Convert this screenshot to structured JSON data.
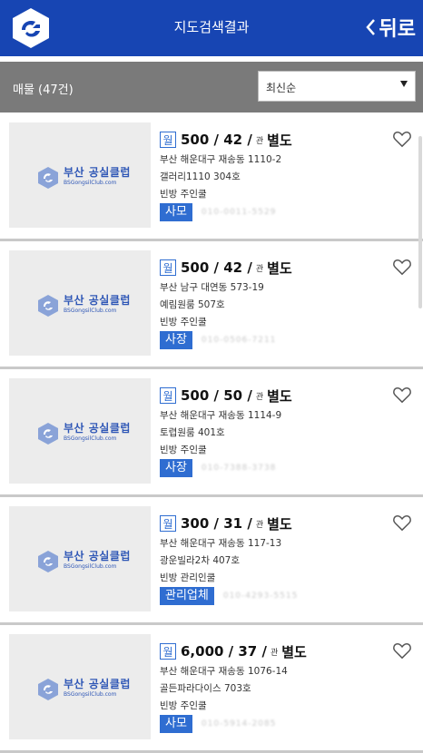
{
  "header": {
    "title": "지도검색결과",
    "back_label": "뒤로"
  },
  "toolbar": {
    "count_label": "매물 (47건)",
    "sort_selected": "최신순"
  },
  "thumbnail": {
    "brand": "부산 공실클럽",
    "site": "BSGongsilClub.com"
  },
  "listings": [
    {
      "type": "월",
      "price": "500 / 42 /",
      "mgmt_label": "관",
      "mgmt_value": "별도",
      "address": "부산 해운대구 재송동 1110-2",
      "building": "갤러리1110 304호",
      "tags": "빈방    주인쿨",
      "badge": "사모",
      "phone": "010-0011-5529"
    },
    {
      "type": "월",
      "price": "500 / 42 /",
      "mgmt_label": "관",
      "mgmt_value": "별도",
      "address": "부산 남구 대연동 573-19",
      "building": "예림원룸 507호",
      "tags": "빈방    주인쿨",
      "badge": "사장",
      "phone": "010-0506-7211"
    },
    {
      "type": "월",
      "price": "500 / 50 /",
      "mgmt_label": "관",
      "mgmt_value": "별도",
      "address": "부산 해운대구 재송동 1114-9",
      "building": "토렵원룸 401호",
      "tags": "빈방    주인쿨",
      "badge": "사장",
      "phone": "010-7388-3738"
    },
    {
      "type": "월",
      "price": "300 / 31 /",
      "mgmt_label": "관",
      "mgmt_value": "별도",
      "address": "부산 해운대구 재송동 117-13",
      "building": "광운빌라2차 407호",
      "tags": "빈방    관리인쿨",
      "badge": "관리업체",
      "phone": "010-4293-5515"
    },
    {
      "type": "월",
      "price": "6,000 / 37 /",
      "mgmt_label": "관",
      "mgmt_value": "별도",
      "address": "부산 해운대구 재송동 1076-14",
      "building": "골든파라다이스 703호",
      "tags": "빈방    주인쿨",
      "badge": "사모",
      "phone": "010-5914-2085"
    }
  ],
  "colors": {
    "header_bg": "#1745b3",
    "accent": "#2f6dd1",
    "subbar_bg": "#7a7a7a"
  }
}
